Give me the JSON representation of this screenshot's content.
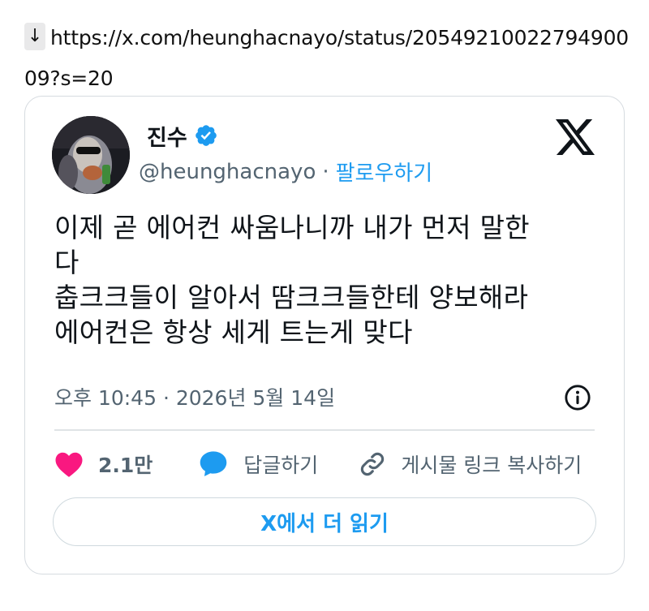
{
  "link": {
    "arrow": "↓",
    "url": "https://x.com/heunghacnayo/status/2054921002279490009?s=20"
  },
  "tweet": {
    "author_name": "진수",
    "verified": true,
    "handle": "@heunghacnayo",
    "separator": "·",
    "follow_label": "팔로우하기",
    "text_lines": [
      "이제 곧 에어컨 싸움나니까 내가 먼저 말한",
      "다",
      "춥크크들이 알아서 땀크크들한테 양보해라",
      "에어컨은 항상 세게 트는게 맞다"
    ],
    "timestamp": "오후 10:45 · 2026년 5월 14일",
    "likes": "2.1만",
    "reply_label": "답글하기",
    "copy_link_label": "게시물 링크 복사하기",
    "read_more_label": "X에서 더 읽기"
  },
  "colors": {
    "accent": "#1d9bf0",
    "like": "#f91880",
    "muted": "#536471",
    "text": "#0f1419"
  },
  "icons": [
    "down-arrow-icon",
    "verified-badge-icon",
    "x-logo-icon",
    "info-icon",
    "heart-icon",
    "reply-bubble-icon",
    "link-icon"
  ]
}
